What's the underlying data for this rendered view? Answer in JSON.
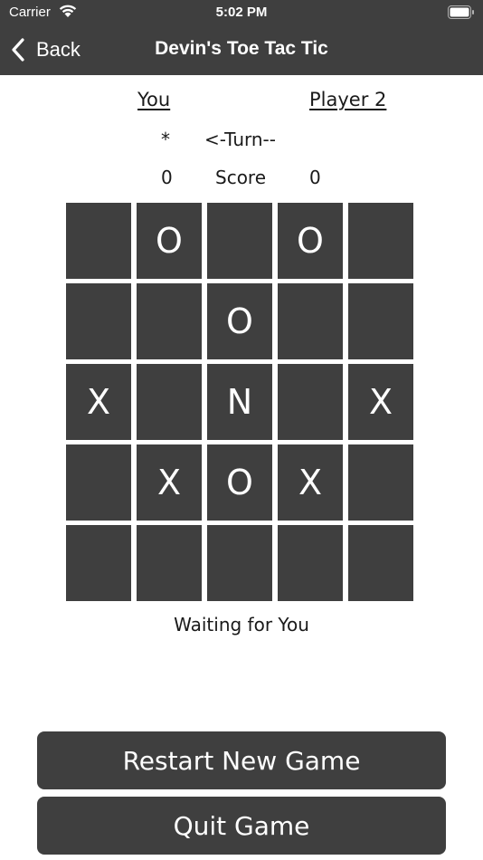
{
  "status_bar": {
    "carrier": "Carrier",
    "time": "5:02 PM"
  },
  "nav": {
    "back_label": "Back",
    "title": "Devin's Toe Tac Tic"
  },
  "players": {
    "player1": "You",
    "player2": "Player 2"
  },
  "turn": {
    "marker": "*",
    "label": "<-Turn--"
  },
  "score": {
    "player1": "0",
    "label": "Score",
    "player2": "0"
  },
  "board": {
    "rows": [
      [
        "",
        "O",
        "",
        "O",
        ""
      ],
      [
        "",
        "",
        "O",
        "",
        ""
      ],
      [
        "X",
        "",
        "N",
        "",
        "X"
      ],
      [
        "",
        "X",
        "O",
        "X",
        ""
      ],
      [
        "",
        "",
        "",
        "",
        ""
      ]
    ]
  },
  "status_text": "Waiting for You",
  "buttons": {
    "restart": "Restart New Game",
    "quit": "Quit Game"
  },
  "colors": {
    "header_bg": "#3f3f3f",
    "cell_bg": "#3f3f3f",
    "button_bg": "#3f3f3f",
    "text_light": "#ffffff",
    "text_dark": "#1a1a1a"
  }
}
